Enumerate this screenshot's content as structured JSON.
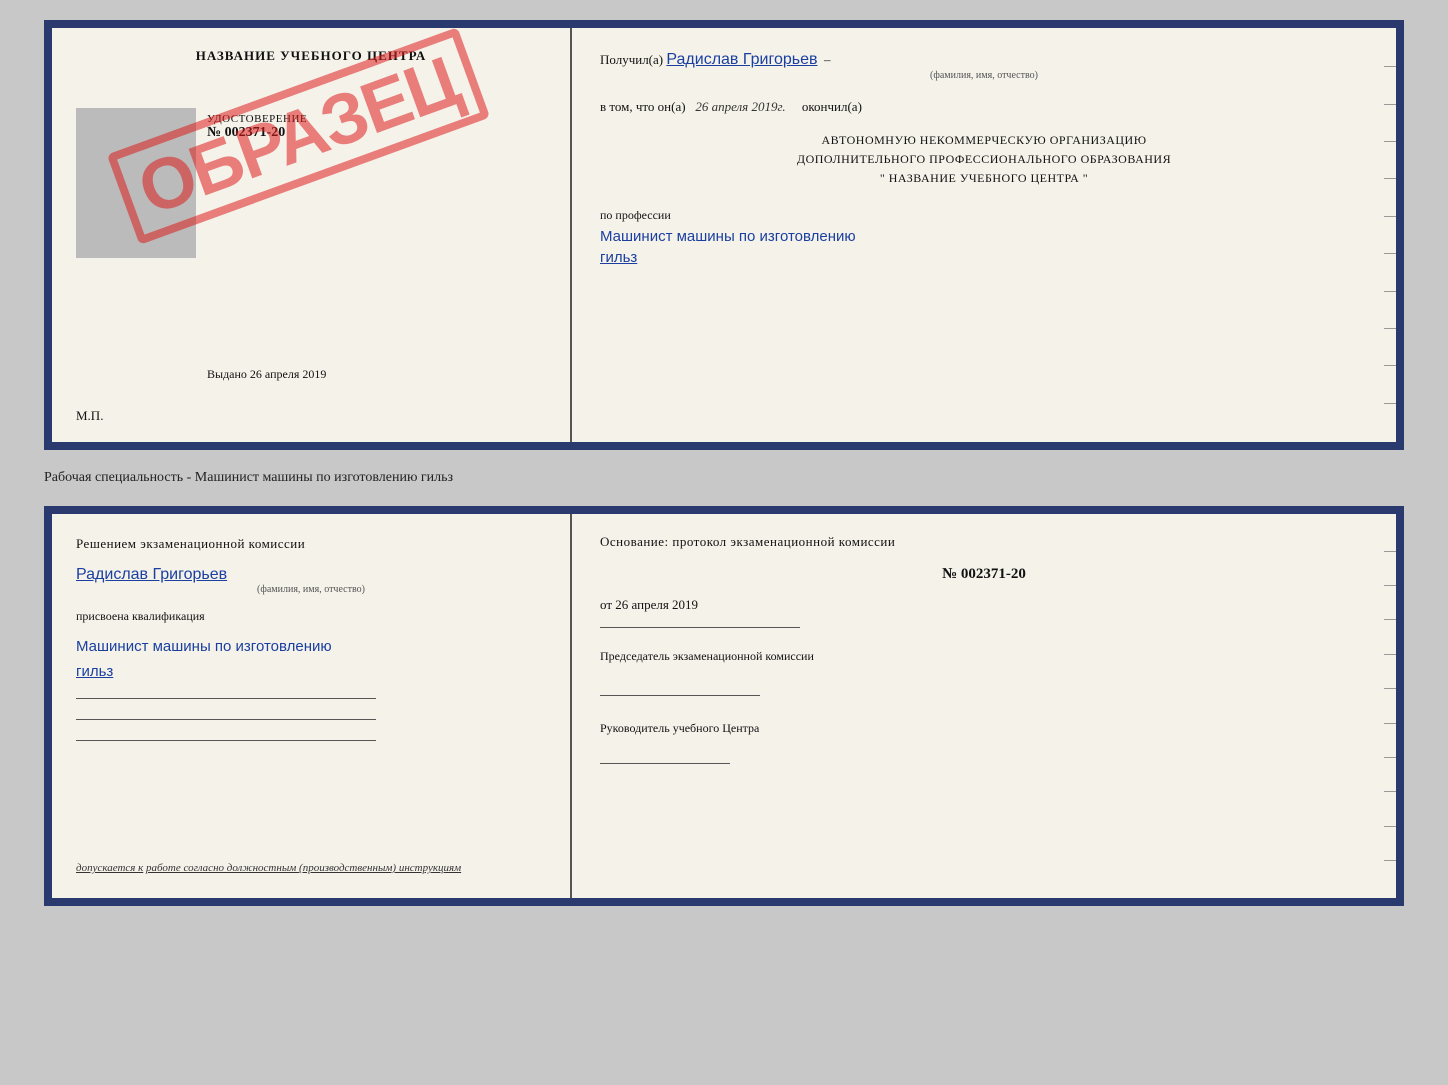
{
  "topCert": {
    "left": {
      "title": "НАЗВАНИЕ УЧЕБНОГО ЦЕНТРА",
      "grayBoxAlt": "photo placeholder",
      "stampText": "ОБРАЗЕЦ",
      "udostoverenie": "УДОСТОВЕРЕНИЕ",
      "number": "№ 002371-20",
      "vydano": "Выдано",
      "vydanoDate": "26 апреля 2019",
      "mp": "М.П."
    },
    "right": {
      "poluchilLabel": "Получил(а)",
      "poluchilFio": "Радислав Григорьев",
      "fioSub": "(фамилия, имя, отчество)",
      "dashAfterFio": "–",
      "vtomChtoLabel": "в том, что он(а)",
      "vtomChtoDate": "26 апреля 2019г.",
      "okonchilLabel": "окончил(а)",
      "avtonomLabel1": "АВТОНОМНУЮ НЕКОММЕРЧЕСКУЮ ОРГАНИЗАЦИЮ",
      "avtonomLabel2": "ДОПОЛНИТЕЛЬНОГО ПРОФЕССИОНАЛЬНОГО ОБРАЗОВАНИЯ",
      "avtonomLabel3": "\"     НАЗВАНИЕ УЧЕБНОГО ЦЕНТРА     \"",
      "poProffesii": "по профессии",
      "professionHandwritten": "Машинист машины по изготовлению",
      "professionHandwritten2": "гильз"
    }
  },
  "middleLabel": {
    "text": "Рабочая специальность - Машинист машины по изготовлению гильз"
  },
  "bottomCert": {
    "left": {
      "titleLine1": "Решением  экзаменационной  комиссии",
      "fio": "Радислав Григорьев",
      "fioSub": "(фамилия, имя, отчество)",
      "prisvoenoLabel": "присвоена квалификация",
      "profHandwritten1": "Машинист машины по изготовлению",
      "profHandwritten2": "гильз",
      "dopuskaetsyaLabel": "допускается к",
      "dopuskaetsyaValue": "работе согласно должностным (производственным) инструкциям"
    },
    "right": {
      "osnovanieLabel": "Основание: протокол экзаменационной  комиссии",
      "number": "№  002371-20",
      "otLabel": "от",
      "otDate": "26 апреля 2019",
      "predsedatelLabel": "Председатель экзаменационной комиссии",
      "rukovoditelLabel": "Руководитель учебного Центра"
    }
  },
  "icons": {}
}
